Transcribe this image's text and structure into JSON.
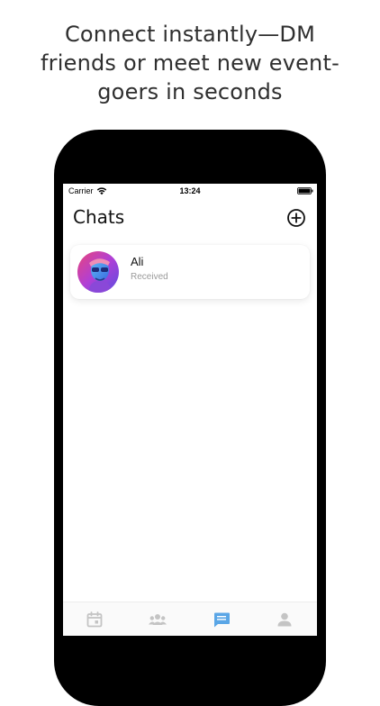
{
  "marketing": {
    "headline_line1": "Connect instantly—DM",
    "headline_line2": "friends or meet new event-",
    "headline_line3": "goers in seconds"
  },
  "status_bar": {
    "carrier": "Carrier",
    "time": "13:24"
  },
  "header": {
    "title": "Chats",
    "add_icon": "plus-circle-icon"
  },
  "chats": [
    {
      "name": "Ali",
      "status": "Received"
    }
  ],
  "tab_bar": {
    "tabs": [
      {
        "icon": "calendar-icon",
        "active": false
      },
      {
        "icon": "group-icon",
        "active": false
      },
      {
        "icon": "chat-bubble-icon",
        "active": true
      },
      {
        "icon": "person-icon",
        "active": false
      }
    ]
  },
  "colors": {
    "active_tab": "#5aa6e6",
    "inactive_tab": "#c4c4c4",
    "phone_frame": "#000000"
  }
}
